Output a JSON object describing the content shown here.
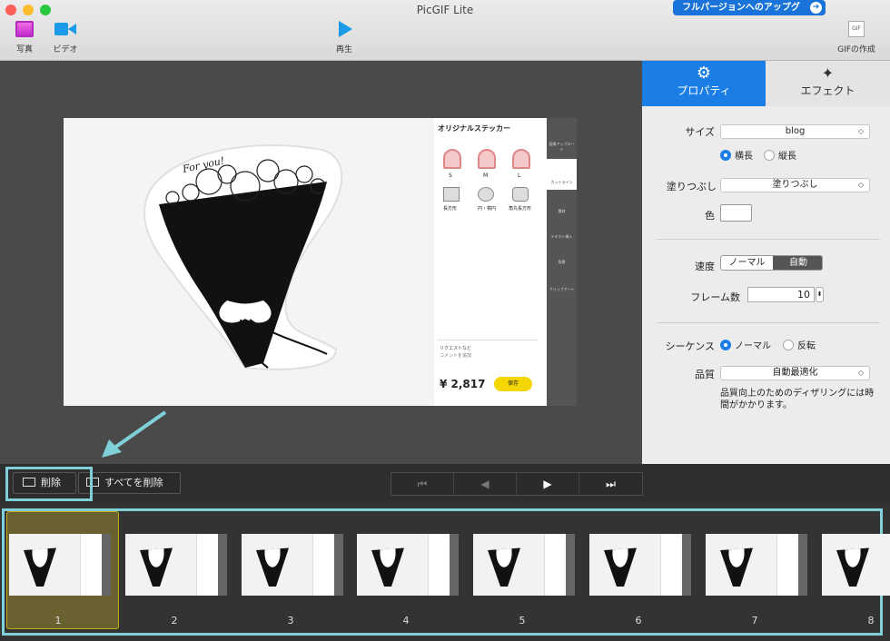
{
  "window": {
    "title": "PicGIF Lite",
    "upgrade_label": "フルパージョンへのアップグ"
  },
  "toolbar": {
    "photo": "写真",
    "video": "ビデオ",
    "play": "再生",
    "create_gif": "GIFの作成",
    "gif_badge": "GIF"
  },
  "canvas": {
    "header": "オリジナルステッカー",
    "sizes": [
      "S",
      "M",
      "L"
    ],
    "shapes": [
      "長方形",
      "円・楕円",
      "角丸長方形"
    ],
    "sidebar": [
      "画像アップロード",
      "カットライン",
      "素材",
      "テキスト挿入",
      "背景",
      "クリップアート"
    ],
    "price": "¥ 2,817",
    "save": "保存",
    "comment": "リクエストなど",
    "comment_sub": "コメントを追加",
    "for_you": "For you!"
  },
  "panel": {
    "tab_properties": "プロパティ",
    "tab_effects": "エフェクト",
    "size_label": "サイズ",
    "size_value": "blog",
    "orient_landscape": "横長",
    "orient_portrait": "縦長",
    "fill_label": "塗りつぶし",
    "fill_value": "塗りつぶし",
    "color_label": "色",
    "color_value": "#ffffff",
    "speed_label": "速度",
    "speed_normal": "ノーマル",
    "speed_auto": "自動",
    "frames_label": "フレーム数",
    "frames_value": "10",
    "sequence_label": "シーケンス",
    "seq_normal": "ノーマル",
    "seq_reverse": "反転",
    "quality_label": "品質",
    "quality_value": "自動最適化",
    "quality_note": "品質向上のためのディザリングには時間がかかります。"
  },
  "bottom": {
    "delete": "削除",
    "delete_all": "すべてを削除"
  },
  "frames": [
    "1",
    "2",
    "3",
    "4",
    "5",
    "6",
    "7",
    "8"
  ],
  "colors": {
    "accent": "#1a7ee6",
    "highlight": "#7fd0d8",
    "selected_frame": "#f0c400"
  }
}
